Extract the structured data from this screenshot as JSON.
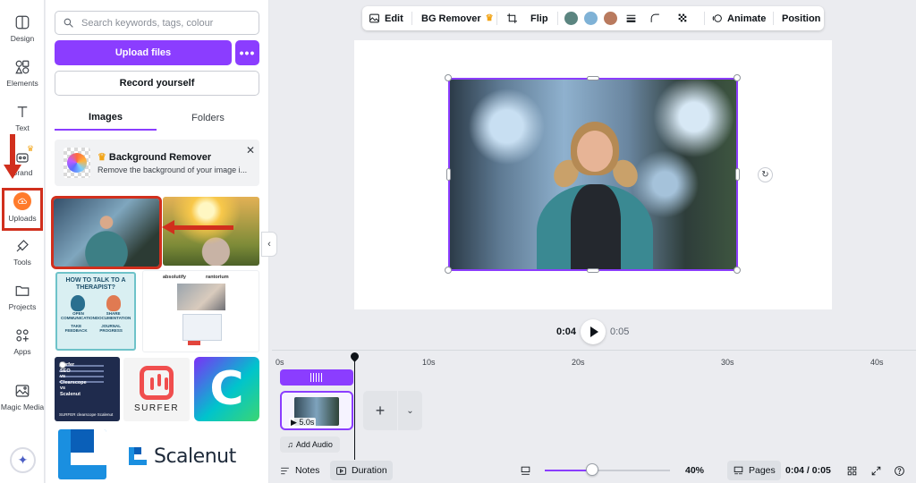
{
  "rail": {
    "design": "Design",
    "elements": "Elements",
    "text": "Text",
    "brand": "Brand",
    "uploads": "Uploads",
    "tools": "Tools",
    "projects": "Projects",
    "apps": "Apps",
    "magic_media": "Magic Media"
  },
  "panel": {
    "search_placeholder": "Search keywords, tags, colour",
    "upload_button": "Upload files",
    "more_button": "•••",
    "record_button": "Record yourself",
    "tabs": [
      "Images",
      "Folders"
    ],
    "bg_remover": {
      "title": "Background Remover",
      "desc": "Remove the background of your image i..."
    },
    "thumbs": {
      "therapist_title": "HOW TO TALK TO A THERAPIST?",
      "therapist_caps": [
        "OPEN COMMUNICATION",
        "SHARE DOCUMENTATION",
        "TAKE FEEDBACK",
        "JOURNAL PROGRESS"
      ],
      "doc_brands": [
        "absolutify",
        "rantorium"
      ],
      "surferseo_title": "Surfer SEO vs Clearscope vs Scalenut",
      "surferseo_foot": "SURFER  clearscope  Scalenut",
      "surfer_name": "SURFER",
      "canva_letter": "C",
      "scalenut_name": "Scalenut"
    }
  },
  "toolbar": {
    "edit": "Edit",
    "bg_remover": "BG Remover",
    "flip": "Flip",
    "colors": [
      "#5b8580",
      "#7fb2d6",
      "#b97a5e"
    ],
    "animate": "Animate",
    "position": "Position"
  },
  "playback": {
    "current": "0:04",
    "total": "0:05"
  },
  "timeline": {
    "ticks": [
      "0s",
      "10s",
      "20s",
      "30s",
      "40s"
    ],
    "clip_duration": "5.0s",
    "add_audio": "Add Audio"
  },
  "bottom": {
    "notes": "Notes",
    "duration": "Duration",
    "zoom_level": 40,
    "zoom": "40%",
    "pages": "Pages",
    "page_time": "0:04 / 0:05"
  },
  "colors": {
    "accent": "#8b3dff",
    "annotation_red": "#d12f1d",
    "upload_orange": "#ff7b2c"
  }
}
